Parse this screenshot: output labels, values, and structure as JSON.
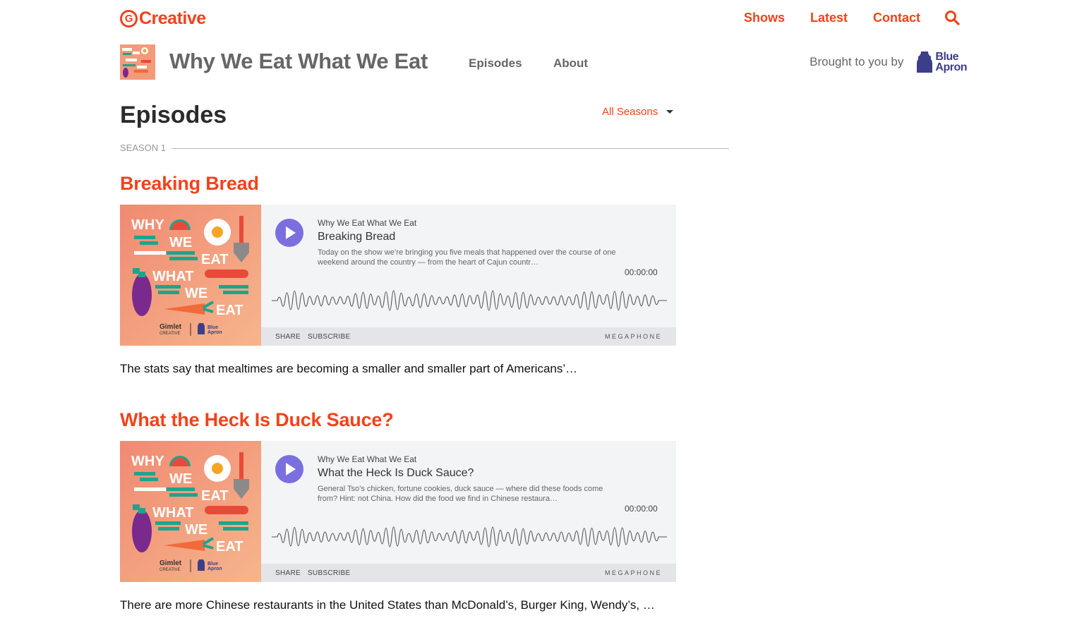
{
  "brand": {
    "name": "Creative",
    "mark": "G",
    "accent_color": "#f2421b"
  },
  "topnav": {
    "items": [
      {
        "label": "Shows"
      },
      {
        "label": "Latest"
      },
      {
        "label": "Contact"
      }
    ],
    "search_icon": "search-icon"
  },
  "show": {
    "title": "Why We Eat What We Eat",
    "nav": [
      {
        "label": "Episodes"
      },
      {
        "label": "About"
      }
    ],
    "sponsor_prefix": "Brought to you by",
    "sponsor_name_line1": "Blue",
    "sponsor_name_line2": "Apron"
  },
  "page": {
    "heading": "Episodes",
    "season_filter": "All Seasons",
    "season_label": "SEASON 1"
  },
  "player_common": {
    "share_label": "SHARE",
    "subscribe_label": "SUBSCRIBE",
    "brand": "MEGAPHONE",
    "play_color": "#7b6fe0"
  },
  "artwork": {
    "line1": "WHY",
    "line2": "WE",
    "line3": "EAT",
    "line4": "WHAT",
    "line5": "WE",
    "line6": "EAT",
    "credit_left_1": "Gimlet",
    "credit_left_2": "CREATIVE",
    "credit_right_1": "Blue",
    "credit_right_2": "Apron"
  },
  "episodes": [
    {
      "title": "Breaking Bread",
      "player": {
        "show": "Why We Eat What We Eat",
        "title": "Breaking Bread",
        "description": "Today on the show we’re bringing you five meals that happened over the course of one weekend around the country — from the heart of Cajun countr…",
        "time": "00:00:00"
      },
      "summary": "The stats say that mealtimes are becoming a smaller and smaller part of Americans’…"
    },
    {
      "title": "What the Heck Is Duck Sauce?",
      "player": {
        "show": "Why We Eat What We Eat",
        "title": "What the Heck Is Duck Sauce?",
        "description": "General Tso’s chicken, fortune cookies, duck sauce — where did these foods come from? Hint: not China. How did the food we find in Chinese restaura…",
        "time": "00:00:00"
      },
      "summary": "There are more Chinese restaurants in the United States than McDonald’s, Burger King, Wendy’s, …"
    }
  ]
}
